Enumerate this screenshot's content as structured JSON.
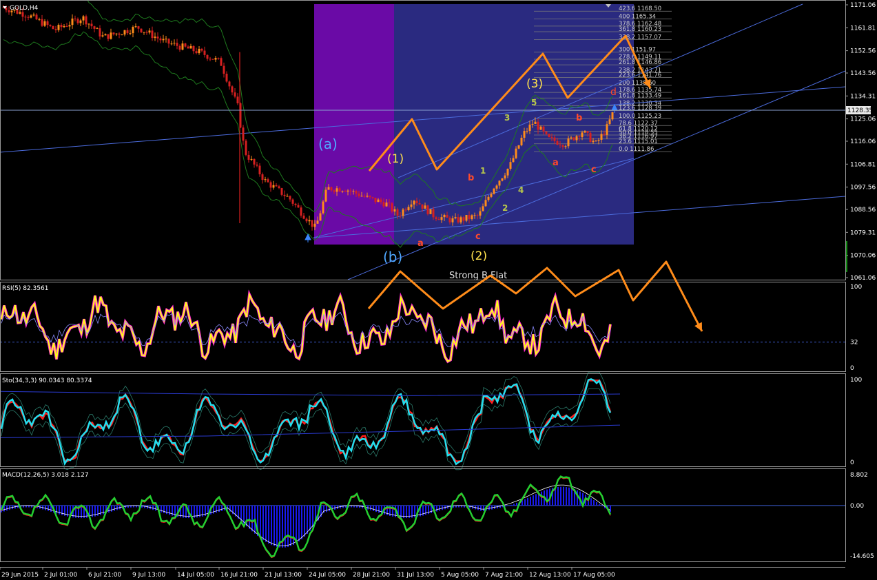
{
  "chart_data": [
    {
      "type": "candlestick",
      "title": "GOLD,H4",
      "y_ticks": [
        "1171.06",
        "1161.81",
        "1152.56",
        "1143.56",
        "1134.31",
        "1125.06",
        "1116.06",
        "1106.81",
        "1097.56",
        "1088.56",
        "1079.31",
        "1070.06",
        "1061.06"
      ],
      "ylim": [
        1061.06,
        1171.06
      ],
      "current_price": "1128.35",
      "x_ticks": [
        "29 Jun 2015",
        "2 Jul 01:00",
        "6 Jul 21:00",
        "9 Jul 13:00",
        "14 Jul 05:00",
        "16 Jul 21:00",
        "21 Jul 13:00",
        "24 Jul 05:00",
        "28 Jul 21:00",
        "31 Jul 13:00",
        "5 Aug 05:00",
        "7 Aug 21:00",
        "12 Aug 13:00",
        "17 Aug 05:00"
      ],
      "fibonacci_levels": [
        {
          "pct": "423.6",
          "price": "1168.50"
        },
        {
          "pct": "400",
          "price": "1165.34"
        },
        {
          "pct": "378.6",
          "price": "1162.48"
        },
        {
          "pct": "361.8",
          "price": "1160.23"
        },
        {
          "pct": "338.2",
          "price": "1157.07"
        },
        {
          "pct": "300",
          "price": "1151.97"
        },
        {
          "pct": "278.6",
          "price": "1149.11"
        },
        {
          "pct": "261.8",
          "price": "1146.86"
        },
        {
          "pct": "238.2",
          "price": "1143.71"
        },
        {
          "pct": "223.6",
          "price": "1141.76"
        },
        {
          "pct": "200",
          "price": "1138.60"
        },
        {
          "pct": "178.6",
          "price": "1135.74"
        },
        {
          "pct": "161.8",
          "price": "1133.49"
        },
        {
          "pct": "138.2",
          "price": "1130.34"
        },
        {
          "pct": "123.6",
          "price": "1128.39"
        },
        {
          "pct": "100.0",
          "price": "1125.23"
        },
        {
          "pct": "78.6",
          "price": "1122.37"
        },
        {
          "pct": "61.8",
          "price": "1120.12"
        },
        {
          "pct": "50.0",
          "price": "1118.55"
        },
        {
          "pct": "38.2",
          "price": "1116.97"
        },
        {
          "pct": "23.6",
          "price": "1115.01"
        },
        {
          "pct": "0.0",
          "price": "1111.86"
        }
      ],
      "wave_labels": [
        {
          "text": "(a)",
          "color": "#4fa8ff"
        },
        {
          "text": "(b)",
          "color": "#4fa8ff"
        },
        {
          "text": "(1)",
          "color": "#ffe14d"
        },
        {
          "text": "(2)",
          "color": "#ffe14d"
        },
        {
          "text": "(3)",
          "color": "#ffe14d"
        },
        {
          "text": "a",
          "color": "#ff4a2a"
        },
        {
          "text": "c",
          "color": "#ff4a2a"
        },
        {
          "text": "b",
          "color": "#ff4a2a"
        },
        {
          "text": "a",
          "color": "#ff4a2a"
        },
        {
          "text": "b",
          "color": "#ff4a2a"
        },
        {
          "text": "c",
          "color": "#ff4a2a"
        },
        {
          "text": "d",
          "color": "#ff4a2a"
        },
        {
          "text": "1",
          "color": "#b8c84a"
        },
        {
          "text": "2",
          "color": "#b8c84a"
        },
        {
          "text": "3",
          "color": "#b8c84a"
        },
        {
          "text": "4",
          "color": "#b8c84a"
        },
        {
          "text": "5",
          "color": "#b8c84a"
        }
      ],
      "annotation": "Strong B Flat",
      "colors": {
        "bull": "#ff8c1a",
        "bear": "#d62020",
        "bands": "#1e7a1e",
        "purple_zone": "#6a0aa6",
        "blue_zone": "#2a2a80",
        "trendline": "#4b6bdc",
        "arrow": "#ff8c1a"
      }
    },
    {
      "type": "line",
      "title": "RSI(5) 82.3561",
      "y_ticks": [
        "100",
        "32",
        "0"
      ],
      "ylim": [
        0,
        100
      ],
      "level": 32
    },
    {
      "type": "line",
      "title": "Sto(34,3,3) 90.0343 80.3374",
      "y_ticks": [
        "100",
        "0"
      ],
      "ylim": [
        0,
        100
      ]
    },
    {
      "type": "histogram",
      "title": "MACD(12,26,5) 3.018 2.127",
      "y_ticks": [
        "8.802",
        "0.00",
        "-14.605"
      ],
      "ylim": [
        -14.605,
        8.802
      ]
    }
  ]
}
